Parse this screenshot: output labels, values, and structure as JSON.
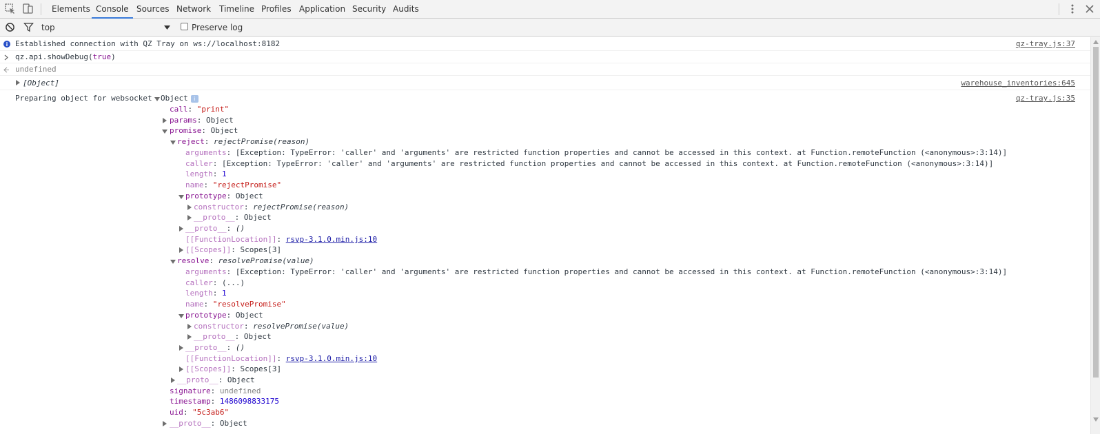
{
  "toolbar": {
    "tabs": [
      "Elements",
      "Console",
      "Sources",
      "Network",
      "Timeline",
      "Profiles",
      "Application",
      "Security",
      "Audits"
    ],
    "active_tab": "Console"
  },
  "filter": {
    "context": "top",
    "preserve_log_label": "Preserve log"
  },
  "messages": {
    "m1": {
      "text": "Established connection with QZ Tray on ws://localhost:8182",
      "source": "qz-tray.js:37"
    },
    "m2": {
      "input": "qz.api.showDebug(",
      "input_arg": "true",
      "input_end": ")"
    },
    "m3": {
      "result": "undefined"
    },
    "m4": {
      "text": "[Object]",
      "source": "warehouse_inventories:645"
    },
    "m5": {
      "prefix": "Preparing object for websocket",
      "obj": "Object",
      "source": "qz-tray.js:35"
    }
  },
  "tree": {
    "call_key": "call",
    "call_val": "\"print\"",
    "params_key": "params",
    "params_val": "Object",
    "promise_key": "promise",
    "promise_val": "Object",
    "reject_key": "reject",
    "reject_val": "rejectPromise(reason)",
    "arguments_key": "arguments",
    "exception": "[Exception: TypeError: 'caller' and 'arguments' are restricted function properties and cannot be accessed in this context. at Function.remoteFunction (<anonymous>:3:14)]",
    "caller_key": "caller",
    "length_key": "length",
    "length_val": "1",
    "name_key": "name",
    "reject_name": "\"rejectPromise\"",
    "prototype_key": "prototype",
    "prototype_val": "Object",
    "constructor_key": "constructor",
    "reject_ctor": "rejectPromise(reason)",
    "proto_key": "__proto__",
    "proto_obj": "Object",
    "proto_fn": "()",
    "funcloc_key": "[[FunctionLocation]]",
    "funcloc_val": "rsvp-3.1.0.min.js:10",
    "scopes_key": "[[Scopes]]",
    "scopes_val": "Scopes[3]",
    "resolve_key": "resolve",
    "resolve_val": "resolvePromise(value)",
    "caller_dots": "(...)",
    "resolve_name": "\"resolvePromise\"",
    "resolve_ctor": "resolvePromise(value)",
    "signature_key": "signature",
    "signature_val": "undefined",
    "timestamp_key": "timestamp",
    "timestamp_val": "1486098833175",
    "uid_key": "uid",
    "uid_val": "\"5c3ab6\""
  },
  "colors": {
    "accent": "#3879d9",
    "property": "#881391",
    "string": "#c41a16",
    "number": "#1c00cf",
    "link": "#1a1aa6"
  }
}
